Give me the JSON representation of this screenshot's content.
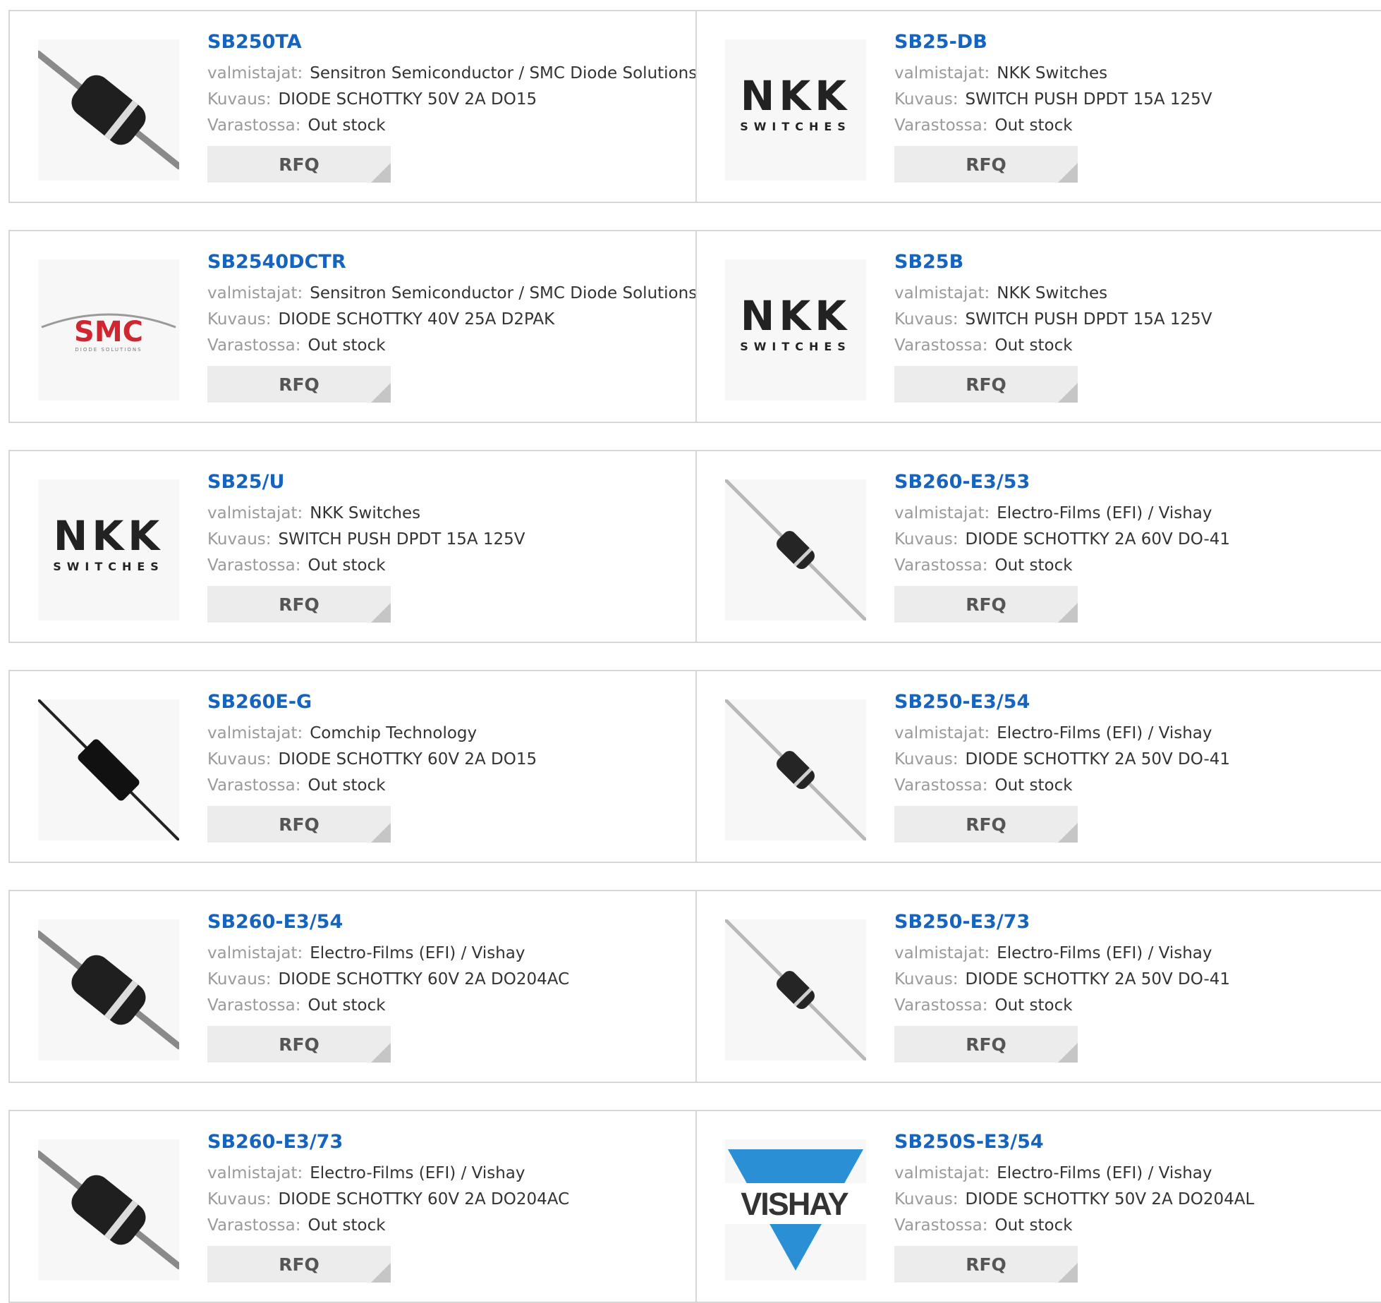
{
  "labels": {
    "manufacturer": "valmistajat:",
    "description": "Kuvaus:",
    "stock": "Varastossa:",
    "rfq": "RFQ"
  },
  "colors": {
    "link": "#1565c0",
    "border": "#d6d6d6",
    "button_bg": "#ececec",
    "vishay_blue": "#2a8fd4",
    "smc_red": "#d0262f"
  },
  "products": [
    {
      "part": "SB250TA",
      "manufacturer": "Sensitron Semiconductor / SMC Diode Solutions",
      "description": "DIODE SCHOTTKY 50V 2A DO15",
      "stock": "Out stock",
      "image": "diode-large-icon"
    },
    {
      "part": "SB25-DB",
      "manufacturer": "NKK Switches",
      "description": "SWITCH PUSH DPDT 15A 125V",
      "stock": "Out stock",
      "image": "nkk-logo",
      "logo_text": {
        "main": "NKK",
        "sub": "SWITCHES"
      }
    },
    {
      "part": "SB2540DCTR",
      "manufacturer": "Sensitron Semiconductor / SMC Diode Solutions",
      "description": "DIODE SCHOTTKY 40V 25A D2PAK",
      "stock": "Out stock",
      "image": "smc-logo",
      "logo_text": {
        "main": "SMC",
        "sub": "DIODE SOLUTIONS"
      }
    },
    {
      "part": "SB25B",
      "manufacturer": "NKK Switches",
      "description": "SWITCH PUSH DPDT 15A 125V",
      "stock": "Out stock",
      "image": "nkk-logo",
      "logo_text": {
        "main": "NKK",
        "sub": "SWITCHES"
      }
    },
    {
      "part": "SB25/U",
      "manufacturer": "NKK Switches",
      "description": "SWITCH PUSH DPDT 15A 125V",
      "stock": "Out stock",
      "image": "nkk-logo",
      "logo_text": {
        "main": "NKK",
        "sub": "SWITCHES"
      }
    },
    {
      "part": "SB260-E3/53",
      "manufacturer": "Electro-Films (EFI) / Vishay",
      "description": "DIODE SCHOTTKY 2A 60V DO-41",
      "stock": "Out stock",
      "image": "diode-thin-icon"
    },
    {
      "part": "SB260E-G",
      "manufacturer": "Comchip Technology",
      "description": "DIODE SCHOTTKY 60V 2A DO15",
      "stock": "Out stock",
      "image": "diode-black-icon"
    },
    {
      "part": "SB250-E3/54",
      "manufacturer": "Electro-Films (EFI) / Vishay",
      "description": "DIODE SCHOTTKY 2A 50V DO-41",
      "stock": "Out stock",
      "image": "diode-thin-icon"
    },
    {
      "part": "SB260-E3/54",
      "manufacturer": "Electro-Films (EFI) / Vishay",
      "description": "DIODE SCHOTTKY 60V 2A DO204AC",
      "stock": "Out stock",
      "image": "diode-large-icon"
    },
    {
      "part": "SB250-E3/73",
      "manufacturer": "Electro-Films (EFI) / Vishay",
      "description": "DIODE SCHOTTKY 2A 50V DO-41",
      "stock": "Out stock",
      "image": "diode-thin-icon"
    },
    {
      "part": "SB260-E3/73",
      "manufacturer": "Electro-Films (EFI) / Vishay",
      "description": "DIODE SCHOTTKY 60V 2A DO204AC",
      "stock": "Out stock",
      "image": "diode-large-icon"
    },
    {
      "part": "SB250S-E3/54",
      "manufacturer": "Electro-Films (EFI) / Vishay",
      "description": "DIODE SCHOTTKY 50V 2A DO204AL",
      "stock": "Out stock",
      "image": "vishay-logo",
      "logo_text": {
        "main": "VISHAY"
      }
    }
  ]
}
